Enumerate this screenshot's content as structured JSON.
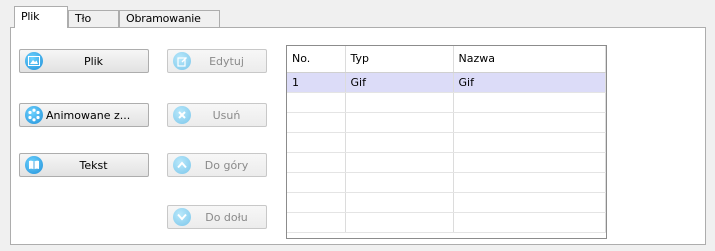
{
  "tabs": [
    {
      "label": "Plik",
      "active": true
    },
    {
      "label": "Tło",
      "active": false
    },
    {
      "label": "Obramowanie",
      "active": false
    }
  ],
  "left_buttons": {
    "plik": {
      "label": "Plik",
      "icon": "picture-icon"
    },
    "animowane": {
      "label": "Animowane z...",
      "icon": "spinner-icon"
    },
    "tekst": {
      "label": "Tekst",
      "icon": "book-icon"
    }
  },
  "action_buttons": {
    "edytuj": {
      "label": "Edytuj",
      "icon": "edit-icon",
      "enabled": false
    },
    "usun": {
      "label": "Usuń",
      "icon": "remove-icon",
      "enabled": false
    },
    "do_gory": {
      "label": "Do góry",
      "icon": "arrow-up-icon",
      "enabled": false
    },
    "do_dolu": {
      "label": "Do dołu",
      "icon": "arrow-down-icon",
      "enabled": false
    }
  },
  "grid": {
    "columns": [
      "No.",
      "Typ",
      "Nazwa"
    ],
    "rows": [
      {
        "no": "1",
        "typ": "Gif",
        "nazwa": "Gif",
        "selected": true
      }
    ],
    "selected_color": "#dcdcf8"
  },
  "colors": {
    "accent_blue": "#1f8fd8",
    "disabled_icon": "#7cc6ea"
  }
}
